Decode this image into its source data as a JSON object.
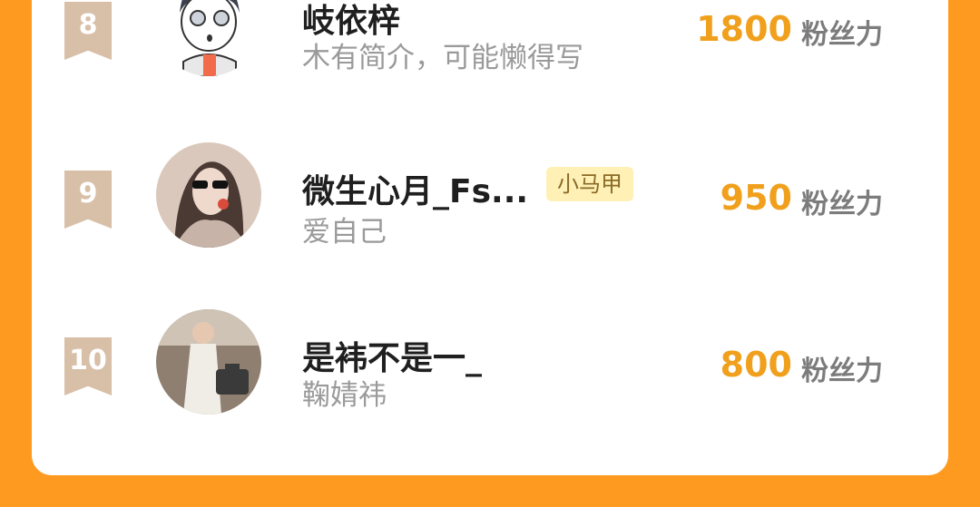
{
  "ranking": {
    "unit_label": "粉丝力",
    "rows": [
      {
        "rank": "8",
        "name": "岐依梓",
        "bio": "木有简介，可能懒得写",
        "score": "1800",
        "avatar_icon": "cartoon-boy-avatar"
      },
      {
        "rank": "9",
        "name": "微生心月_Fs...",
        "tag": "小马甲",
        "bio": "爱自己",
        "score": "950",
        "avatar_icon": "woman-sunglasses-avatar"
      },
      {
        "rank": "10",
        "name": "是袆不是一_",
        "bio": "鞠婧祎",
        "score": "800",
        "avatar_icon": "woman-suitcase-avatar"
      }
    ]
  },
  "colors": {
    "background": "#ff9a20",
    "score": "#f0a01c",
    "rank_badge": "#d8bfa8",
    "tag_bg": "#fff0b5"
  }
}
